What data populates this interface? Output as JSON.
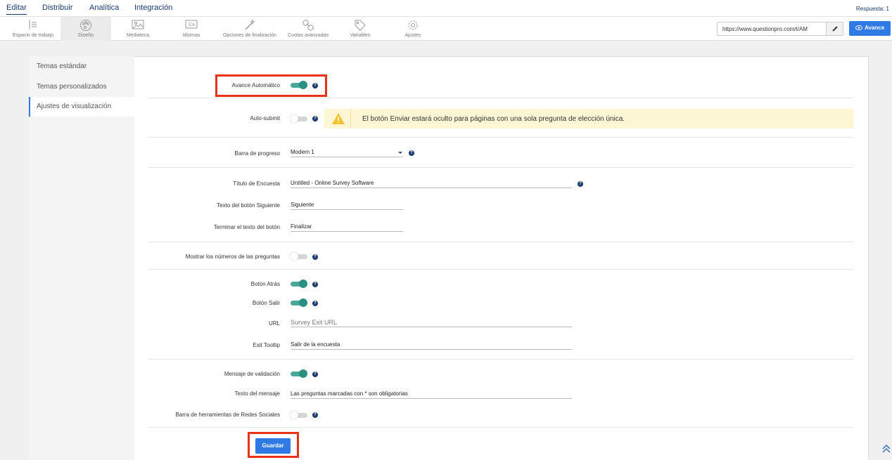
{
  "nav": {
    "tabs": [
      "Editar",
      "Distribuir",
      "Analítica",
      "Integración"
    ],
    "response_label": "Respuesta: 1"
  },
  "toolbar": {
    "items": [
      {
        "label": "Espacio de trabajo",
        "icon": "workspace-icon"
      },
      {
        "label": "Diseño",
        "icon": "palette-icon"
      },
      {
        "label": "Mediateca",
        "icon": "image-icon"
      },
      {
        "label": "Idiomas",
        "icon": "translate-icon"
      },
      {
        "label": "Opciones de finalización",
        "icon": "magic-wand-icon"
      },
      {
        "label": "Cuotas avanzadas",
        "icon": "link-icon"
      },
      {
        "label": "Variables",
        "icon": "tag-icon"
      },
      {
        "label": "Ajustes",
        "icon": "gear-icon"
      }
    ],
    "active": "Diseño",
    "url": "https://www.questionpro.com/t/AM",
    "preview_label": "Avance"
  },
  "sidebar": {
    "items": [
      "Temas estándar",
      "Temas personalizados",
      "Ajustes de visualización"
    ],
    "active": "Ajustes de visualización"
  },
  "settings": {
    "auto_advance": {
      "label": "Avance Automático",
      "on": true
    },
    "auto_submit": {
      "label": "Auto-submit",
      "on": false,
      "warning": "El botón Enviar estará oculto para páginas con una sola pregunta de elección única."
    },
    "progress_bar": {
      "label": "Barra de progreso",
      "value": "Modern 1"
    },
    "survey_title": {
      "label": "Título de Encuesta",
      "value": "Untitled - Online Survey Software"
    },
    "next_button": {
      "label": "Texto del botón Siguiente",
      "value": "Siguiente"
    },
    "finish_button": {
      "label": "Terminar el texto del botón",
      "value": "Finalizar"
    },
    "show_numbers": {
      "label": "Mostrar los números de las preguntas",
      "on": false
    },
    "back_button": {
      "label": "Botón Atrás",
      "on": true
    },
    "exit_button": {
      "label": "Botón Salir",
      "on": true
    },
    "url": {
      "label": "URL",
      "placeholder": "Survey Exit URL"
    },
    "exit_tooltip": {
      "label": "Exit Tooltip",
      "value": "Salir de la encuesta"
    },
    "validation": {
      "label": "Mensaje de validación",
      "on": true
    },
    "message_text": {
      "label": "Texto del mensaje",
      "value": "Las preguntas marcadas con * son obligatorias"
    },
    "social_toolbar": {
      "label": "Barra de herramientas de Redes Sociales",
      "on": false
    }
  },
  "save_label": "Guardar",
  "colors": {
    "accent": "#2f7ae5",
    "toggle_on": "#2a9080",
    "highlight": "#e8321a",
    "nav_text": "#1a3a6c"
  }
}
